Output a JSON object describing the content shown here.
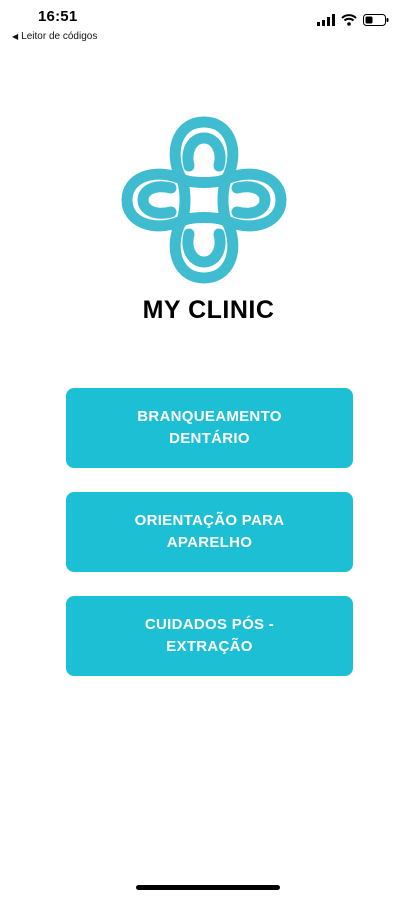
{
  "status_bar": {
    "time": "16:51",
    "back_label": "Leitor de códigos"
  },
  "logo": {
    "icon": "clover-knot-logo",
    "color": "#3FBCD0"
  },
  "app_title": "MY CLINIC",
  "accent_color": "#1DBFD4",
  "menu": [
    {
      "label": "BRANQUEAMENTO DENTÁRIO"
    },
    {
      "label": "ORIENTAÇÃO PARA APARELHO"
    },
    {
      "label": "CUIDADOS PÓS - EXTRAÇÃO"
    }
  ]
}
